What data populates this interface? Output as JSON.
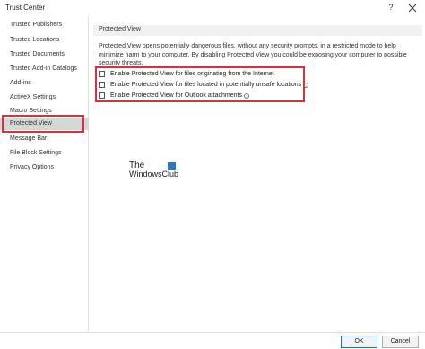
{
  "window": {
    "title": "Trust Center",
    "help_label": "?"
  },
  "sidebar": {
    "items": [
      {
        "label": "Trusted Publishers"
      },
      {
        "label": "Trusted Locations"
      },
      {
        "label": "Trusted Documents"
      },
      {
        "label": "Trusted Add-in Catalogs"
      },
      {
        "label": "Add-ins"
      },
      {
        "label": "ActiveX Settings"
      },
      {
        "label": "Macro Settings"
      },
      {
        "label": "Protected View",
        "active": true
      },
      {
        "label": "Message Bar"
      },
      {
        "label": "File Block Settings"
      },
      {
        "label": "Privacy Options"
      }
    ]
  },
  "main": {
    "section_title": "Protected View",
    "description": "Protected View opens potentially dangerous files, without any security prompts, in a restricted mode to help minimize harm to your computer. By disabling Protected View you could be exposing your computer to possible security threats.",
    "options": [
      {
        "label": "Enable Protected View for files originating from the Internet",
        "checked": false,
        "info": false
      },
      {
        "label": "Enable Protected View for files located in potentially unsafe locations",
        "checked": false,
        "info": true
      },
      {
        "label": "Enable Protected View for Outlook attachments",
        "checked": false,
        "info": true
      }
    ]
  },
  "watermark": {
    "line1": "The",
    "line2": "WindowsClub"
  },
  "footer": {
    "ok_label": "OK",
    "cancel_label": "Cancel"
  },
  "colors": {
    "highlight": "#d4343f",
    "accent": "#0078d7",
    "active_item": "#d6d6d6"
  }
}
